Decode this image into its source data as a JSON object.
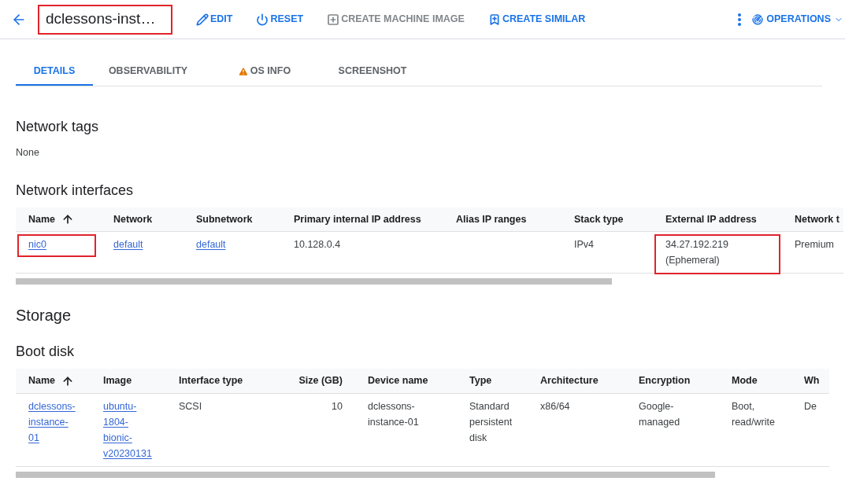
{
  "header": {
    "title": "dclessons-inst…",
    "title_highlighted": true,
    "actions": [
      {
        "kind": "edit",
        "label": "EDIT",
        "disabled": false
      },
      {
        "kind": "reset",
        "label": "RESET",
        "disabled": false
      },
      {
        "kind": "machine-image",
        "label": "CREATE MACHINE IMAGE",
        "disabled": true
      },
      {
        "kind": "similar",
        "label": "CREATE SIMILAR",
        "disabled": false
      }
    ],
    "operations": "OPERATIONS"
  },
  "tabs": [
    {
      "label": "DETAILS",
      "selected": true,
      "warning": false
    },
    {
      "label": "OBSERVABILITY",
      "selected": false,
      "warning": false
    },
    {
      "label": "OS INFO",
      "selected": false,
      "warning": true
    },
    {
      "label": "SCREENSHOT",
      "selected": false,
      "warning": false
    }
  ],
  "network_tags": {
    "title": "Network tags",
    "value": "None"
  },
  "network_interfaces": {
    "title": "Network interfaces",
    "columns": [
      {
        "label": "Name",
        "sorted": true
      },
      {
        "label": "Network",
        "sorted": false
      },
      {
        "label": "Subnetwork",
        "sorted": false
      },
      {
        "label": "Primary internal IP address",
        "sorted": false
      },
      {
        "label": "Alias IP ranges",
        "sorted": false
      },
      {
        "label": "Stack type",
        "sorted": false
      },
      {
        "label": "External IP address",
        "sorted": false
      },
      {
        "label": "Network t",
        "sorted": false
      }
    ],
    "rows": [
      [
        {
          "text": "nic0",
          "kind": "link",
          "highlighted": true
        },
        {
          "text": "default",
          "kind": "link",
          "highlighted": false
        },
        {
          "text": "default",
          "kind": "link",
          "highlighted": false
        },
        {
          "text": "10.128.0.4",
          "kind": "plain",
          "highlighted": false
        },
        {
          "kind": "empty"
        },
        {
          "text": "IPv4",
          "kind": "plain",
          "highlighted": false
        },
        {
          "text": "34.27.192.219 (Ephemeral)",
          "kind": "plain",
          "highlighted": true
        },
        {
          "text": "Premium",
          "kind": "plain",
          "highlighted": false
        }
      ]
    ]
  },
  "storage": {
    "title": "Storage"
  },
  "boot_disk": {
    "title": "Boot disk",
    "columns": [
      {
        "label": "Name",
        "sorted": true,
        "kind": "text"
      },
      {
        "label": "Image",
        "sorted": false,
        "kind": "text"
      },
      {
        "label": "Interface type",
        "sorted": false,
        "kind": "text"
      },
      {
        "label": "Size (GB)",
        "sorted": false,
        "kind": "number"
      },
      {
        "label": "Device name",
        "sorted": false,
        "kind": "text"
      },
      {
        "label": "Type",
        "sorted": false,
        "kind": "text"
      },
      {
        "label": "Architecture",
        "sorted": false,
        "kind": "text"
      },
      {
        "label": "Encryption",
        "sorted": false,
        "kind": "text"
      },
      {
        "label": "Mode",
        "sorted": false,
        "kind": "text"
      },
      {
        "label": "Wh",
        "sorted": false,
        "kind": "text"
      }
    ],
    "rows": [
      [
        {
          "text": "dclessons-instance-01",
          "kind": "link",
          "highlighted": false
        },
        {
          "text": "ubuntu-1804-bionic-v20230131",
          "kind": "link",
          "highlighted": false
        },
        {
          "text": "SCSI",
          "kind": "plain",
          "highlighted": false
        },
        {
          "text": "10",
          "kind": "plain",
          "highlighted": false
        },
        {
          "text": "dclessons-instance-01",
          "kind": "plain",
          "highlighted": false
        },
        {
          "text": "Standard persistent disk",
          "kind": "plain",
          "highlighted": false
        },
        {
          "text": "x86/64",
          "kind": "plain",
          "highlighted": false
        },
        {
          "text": "Google-managed",
          "kind": "plain",
          "highlighted": false
        },
        {
          "text": "Boot, read/write",
          "kind": "plain",
          "highlighted": false
        },
        {
          "text": "De",
          "kind": "plain",
          "highlighted": false
        }
      ]
    ]
  }
}
